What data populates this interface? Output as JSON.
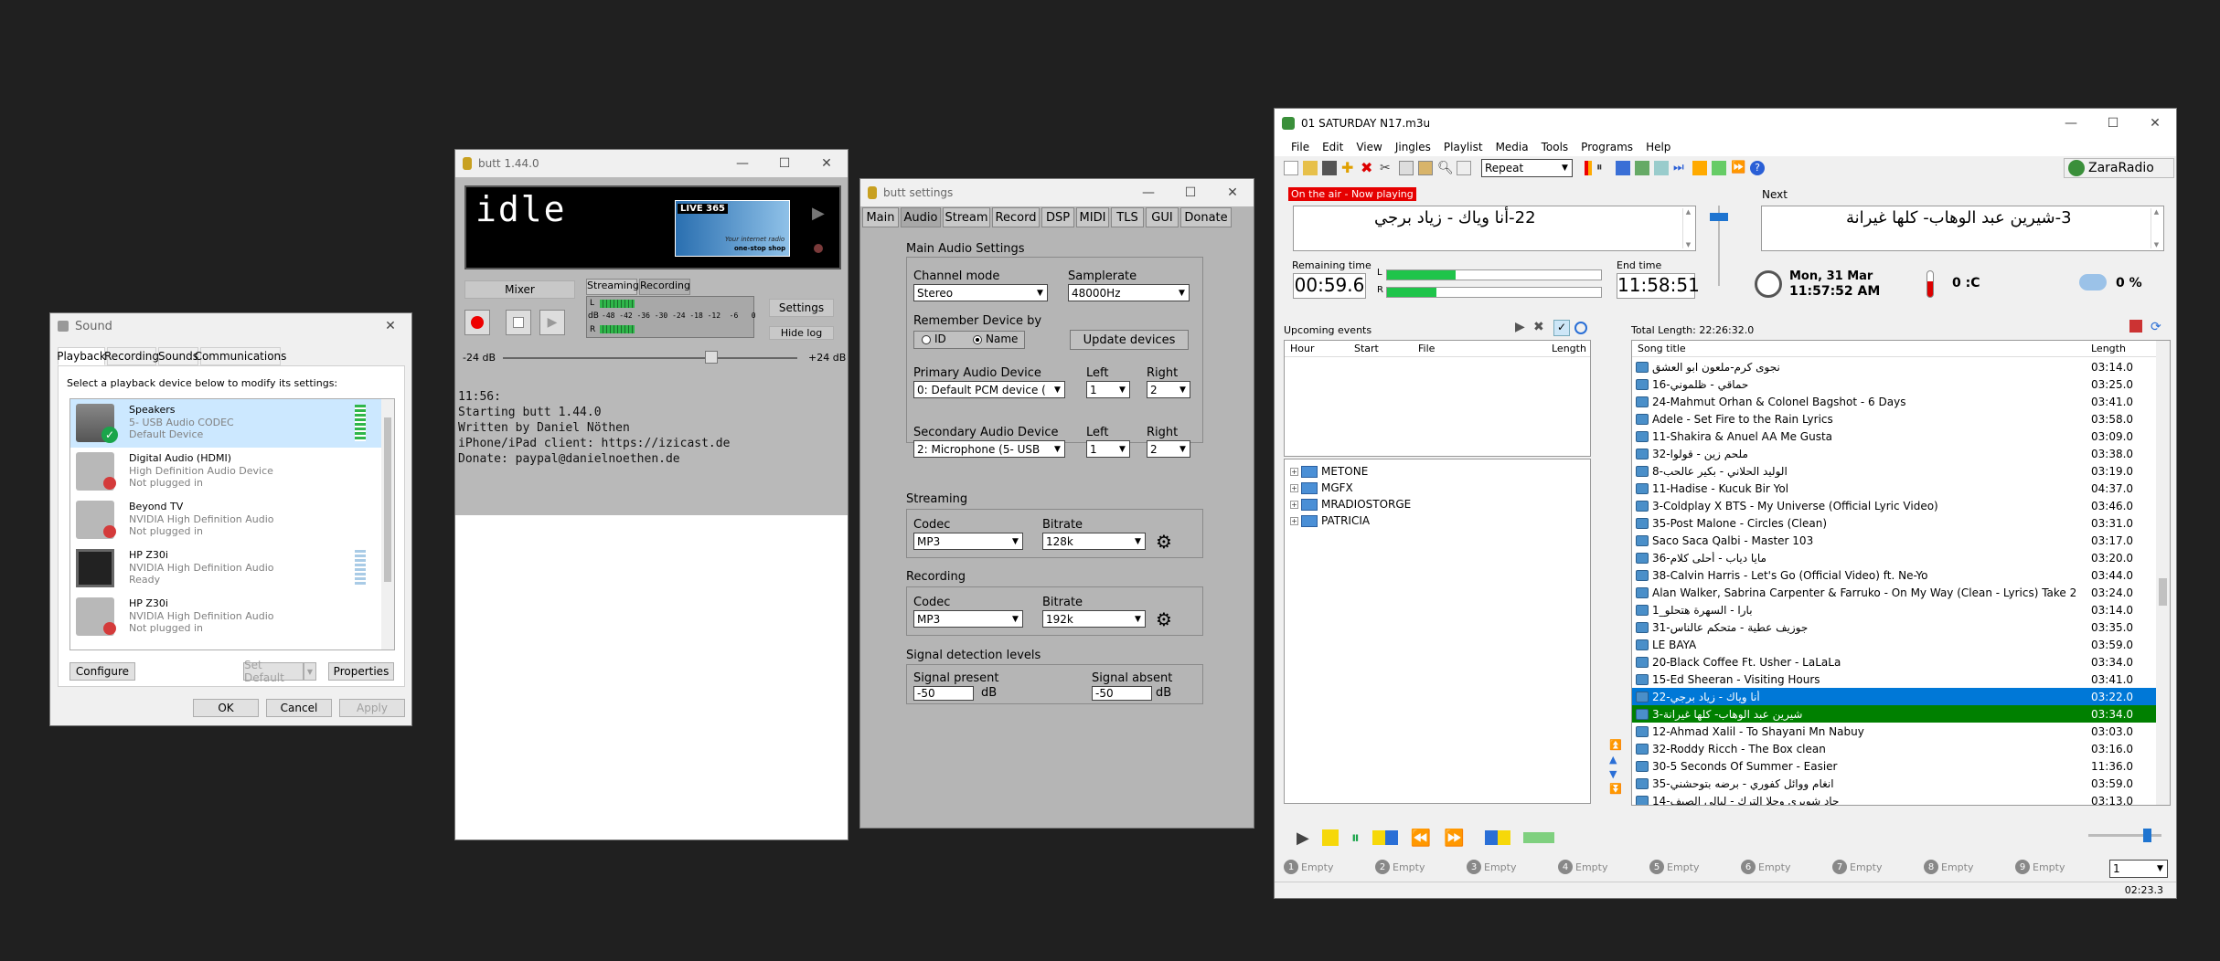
{
  "sound": {
    "title": "Sound",
    "tabs": [
      "Playback",
      "Recording",
      "Sounds",
      "Communications"
    ],
    "instruction": "Select a playback device below to modify its settings:",
    "devices": [
      {
        "name": "Speakers",
        "desc": "5- USB Audio CODEC",
        "status": "Default Device"
      },
      {
        "name": "Digital Audio (HDMI)",
        "desc": "High Definition Audio Device",
        "status": "Not plugged in"
      },
      {
        "name": "Beyond TV",
        "desc": "NVIDIA High Definition Audio",
        "status": "Not plugged in"
      },
      {
        "name": "HP Z30i",
        "desc": "NVIDIA High Definition Audio",
        "status": "Ready"
      },
      {
        "name": "HP Z30i",
        "desc": "NVIDIA High Definition Audio",
        "status": "Not plugged in"
      }
    ],
    "configure": "Configure",
    "set_default": "Set Default",
    "properties": "Properties",
    "ok": "OK",
    "cancel": "Cancel",
    "apply": "Apply"
  },
  "butt": {
    "title": "butt 1.44.0",
    "display": "idle",
    "logo_top": "LIVE 365",
    "logo_text1": "Your internet radio",
    "logo_text2": "one-stop shop",
    "mixer": "Mixer",
    "streaming_tab": "Streaming",
    "recording_tab": "Recording",
    "settings": "Settings",
    "hide_log": "Hide log",
    "vu_scale": "-48 -42 -36 -30 -24 -18 -12  -6   0",
    "vu_l": "L",
    "vu_db": "dB",
    "vu_r": "R",
    "gain_min": "-24 dB",
    "gain_max": "+24 dB",
    "log": [
      "11:56:",
      "Starting butt 1.44.0",
      "Written by Daniel Nöthen",
      "iPhone/iPad client: https://izicast.de",
      "Donate: paypal@danielnoethen.de"
    ]
  },
  "settings": {
    "title": "butt settings",
    "tabs": [
      "Main",
      "Audio",
      "Stream",
      "Record",
      "DSP",
      "MIDI",
      "TLS",
      "GUI",
      "Donate"
    ],
    "main_audio": "Main Audio Settings",
    "channel_mode_label": "Channel mode",
    "channel_mode": "Stereo",
    "samplerate_label": "Samplerate",
    "samplerate": "48000Hz",
    "remember_label": "Remember Device by",
    "opt_id": "ID",
    "opt_name": "Name",
    "update_devices": "Update devices",
    "primary_label": "Primary Audio Device",
    "primary": "0: Default PCM device (",
    "left_label": "Left",
    "right_label": "Right",
    "p_left": "1",
    "p_right": "2",
    "secondary_label": "Secondary Audio Device",
    "secondary": "2: Microphone (5- USB",
    "s_left": "1",
    "s_right": "2",
    "streaming": "Streaming",
    "codec_label": "Codec",
    "bitrate_label": "Bitrate",
    "st_codec": "MP3",
    "st_bitrate": "128k",
    "recording": "Recording",
    "rec_codec": "MP3",
    "rec_bitrate": "192k",
    "signal": "Signal detection levels",
    "present_label": "Signal present",
    "absent_label": "Signal absent",
    "present": "-50",
    "absent": "-50",
    "db": "dB"
  },
  "zara": {
    "title": "01 SATURDAY N17.m3u",
    "menu": [
      "File",
      "Edit",
      "View",
      "Jingles",
      "Playlist",
      "Media",
      "Tools",
      "Programs",
      "Help"
    ],
    "repeat": "Repeat",
    "brand": "ZaraRadio",
    "on_air": "On the air - Now playing",
    "now_playing": "22-أنا وياك - زياد برجي",
    "next_label": "Next",
    "next": "3-شيرين عبد الوهاب- كلها غيرانة",
    "remaining_label": "Remaining time",
    "remaining": "00:59.6",
    "end_label": "End time",
    "end": "11:58:51",
    "lvl_l": "L",
    "lvl_r": "R",
    "date": "Mon, 31 Mar",
    "time": "11:57:52 AM",
    "temp": "0 :C",
    "humidity": "0 %",
    "upcoming": "Upcoming events",
    "ev_cols": [
      "Hour",
      "Start",
      "File",
      "Length"
    ],
    "total": "Total Length: 22:26:32.0",
    "pl_cols": [
      "Song title",
      "Length"
    ],
    "folders": [
      "METONE",
      "MGFX",
      "MRADIOSTORGE",
      "PATRICIA"
    ],
    "songs": [
      {
        "t": "نجوى كرم-ملعون ابو العشق",
        "l": "03:14.0"
      },
      {
        "t": "16-حماقي - ظلموني",
        "l": "03:25.0"
      },
      {
        "t": "24-Mahmut Orhan & Colonel Bagshot - 6 Days",
        "l": "03:41.0"
      },
      {
        "t": "Adele - Set Fire to the Rain Lyrics",
        "l": "03:58.0"
      },
      {
        "t": "11-Shakira & Anuel AA Me Gusta",
        "l": "03:09.0"
      },
      {
        "t": "32-ملحم زين - قولوا",
        "l": "03:38.0"
      },
      {
        "t": "8-الوليد الحلاني - بكير عالحب",
        "l": "03:19.0"
      },
      {
        "t": "11-Hadise - Kucuk Bir Yol",
        "l": "04:37.0"
      },
      {
        "t": "3-Coldplay X BTS - My Universe (Official Lyric Video)",
        "l": "03:46.0"
      },
      {
        "t": "35-Post Malone - Circles (Clean)",
        "l": "03:31.0"
      },
      {
        "t": "Saco Saca Qalbi - Master 103",
        "l": "03:17.0"
      },
      {
        "t": "36-مايا دياب - أحلى كلام",
        "l": "03:20.0"
      },
      {
        "t": "38-Calvin Harris - Let's Go (Official Video) ft. Ne-Yo",
        "l": "03:44.0"
      },
      {
        "t": "Alan Walker, Sabrina Carpenter & Farruko - On My Way (Clean - Lyrics) Take 2",
        "l": "03:24.0"
      },
      {
        "t": "1_بارا - السهرة هتحلو",
        "l": "03:14.0"
      },
      {
        "t": "31-جوزيف عطية - متحكم عالناس",
        "l": "03:35.0"
      },
      {
        "t": "LE BAYA",
        "l": "03:59.0"
      },
      {
        "t": "20-Black Coffee Ft. Usher - LaLaLa",
        "l": "03:34.0"
      },
      {
        "t": "15-Ed Sheeran - Visiting Hours",
        "l": "03:41.0"
      },
      {
        "t": "22-أنا وياك - زياد برجي",
        "l": "03:22.0"
      },
      {
        "t": "3-شيرين عبد الوهاب- كلها غيرانة",
        "l": "03:34.0"
      },
      {
        "t": "12-Ahmad Xalil - To Shayani Mn Nabuy",
        "l": "03:03.0"
      },
      {
        "t": "32-Roddy Ricch - The Box  clean",
        "l": "03:16.0"
      },
      {
        "t": "30-5 Seconds Of Summer - Easier",
        "l": "11:36.0"
      },
      {
        "t": "35-انغام ووائل كفوري - برضه بتوحشني",
        "l": "03:59.0"
      },
      {
        "t": "14-جاد شويري وحلا الترك - ليالي الصيف",
        "l": "03:13.0"
      }
    ],
    "carts": [
      "1",
      "2",
      "3",
      "4",
      "5",
      "6",
      "7",
      "8",
      "9"
    ],
    "cart_label": "Empty",
    "cart_select": "1",
    "status_time": "02:23.3",
    "colors": {
      "playing": "#0078d7",
      "next": "#008000",
      "onair": "#e60000"
    }
  }
}
